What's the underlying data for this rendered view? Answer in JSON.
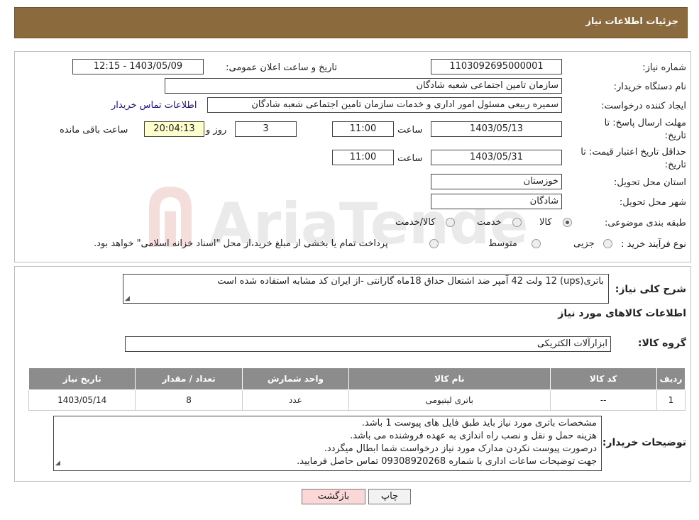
{
  "header": {
    "title": "جزئیات اطلاعات نیاز"
  },
  "watermark": "AriaTender.neT",
  "form": {
    "need_number_label": "شماره نیاز:",
    "need_number": "1103092695000001",
    "announce_label": "تاریخ و ساعت اعلان عمومی:",
    "announce_value": "1403/05/09 - 12:15",
    "buyer_org_label": "نام دستگاه خریدار:",
    "buyer_org": "سازمان تامین اجتماعی شعبه شادگان",
    "creator_label": "ایجاد کننده درخواست:",
    "creator": "سمیره ربیعی مسئول امور اداری و خدمات سازمان تامین اجتماعی شعبه شادگان",
    "contact_link": "اطلاعات تماس خریدار",
    "deadline_label_1": "مهلت ارسال پاسخ: تا",
    "deadline_label_2": "تاریخ:",
    "deadline_date": "1403/05/13",
    "time_label": "ساعت",
    "deadline_time": "11:00",
    "days_value": "3",
    "days_label": "روز و",
    "remaining_value": "20:04:13",
    "remaining_label": "ساعت باقی مانده",
    "validity_label_1": "حداقل تاریخ اعتبار قیمت: تا",
    "validity_label_2": "تاریخ:",
    "validity_date": "1403/05/31",
    "validity_time": "11:00",
    "province_label": "استان محل تحویل:",
    "province": "خوزستان",
    "city_label": "شهر محل تحویل:",
    "city": "شادگان",
    "category_label": "طبقه بندی موضوعی:",
    "category_options": [
      "کالا",
      "خدمت",
      "کالا/خدمت"
    ],
    "process_label": "نوع فرآیند خرید :",
    "process_options": [
      "جزیی",
      "متوسط"
    ],
    "process_note": "پرداخت تمام یا بخشی از مبلغ خرید،از محل \"اسناد خزانه اسلامی\" خواهد بود."
  },
  "summary": {
    "label": "شرح کلی نیاز:",
    "value": "باتری(ups) 12 ولت 42 آمپر ضد اشتعال حداق 18ماه گارانتی  -از ایران کد مشابه استفاده شده است",
    "goods_info_title": "اطلاعات کالاهای مورد نیاز",
    "goods_group_label": "گروه کالا:",
    "goods_group": "ابزارآلات الکتریکی"
  },
  "table": {
    "headers": [
      "ردیف",
      "کد کالا",
      "نام کالا",
      "واحد شمارش",
      "تعداد / مقدار",
      "تاریخ نیاز"
    ],
    "rows": [
      [
        "1",
        "--",
        "باتری لیتیومی",
        "عدد",
        "8",
        "1403/05/14"
      ]
    ]
  },
  "buyer_notes": {
    "label": "توضیحات خریدار:",
    "lines": [
      "مشخصات باتری مورد نیاز باید طبق فایل های پیوست 1  باشد.",
      "هزینه حمل و نقل و نصب راه اندازی به عهده فروشنده می باشد.",
      "درصورت پیوست نکردن مدارک مورد نیاز درخواست شما ابطال میگردد.",
      "جهت توضیحات ساعات اداری با شماره 09308920268 تماس حاصل فرمایید."
    ]
  },
  "buttons": {
    "print": "چاپ",
    "back": "بازگشت"
  },
  "colors": {
    "header_bg": "#8b6a3e",
    "table_header_bg": "#8c8c8c",
    "remaining_bg": "#ffffcc",
    "back_btn_bg": "#fbd7d7",
    "link": "#1a0dab"
  }
}
